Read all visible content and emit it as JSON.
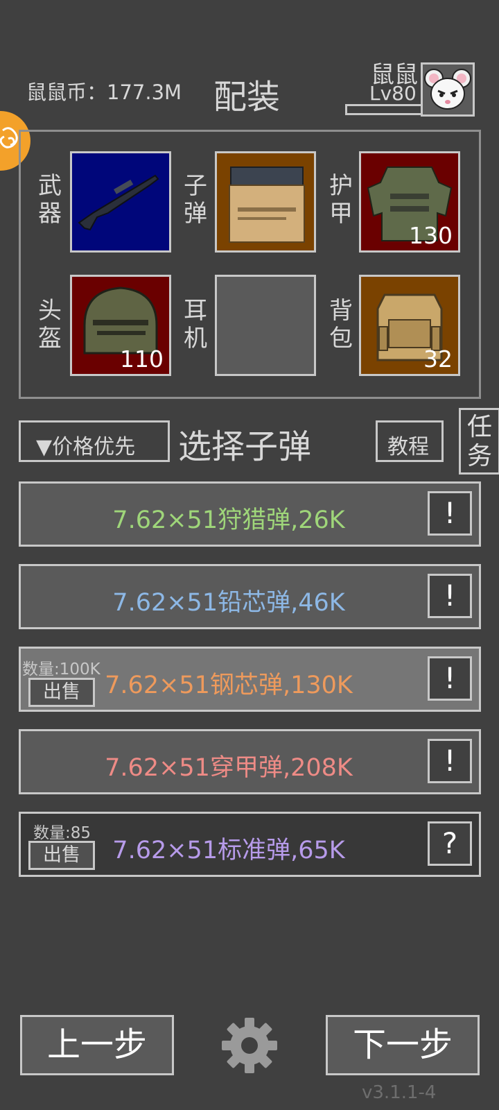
{
  "header": {
    "coins": "鼠鼠币：177.3M",
    "title": "配装",
    "user_name": "鼠鼠",
    "user_level": "Lv80",
    "level_progress": 0.0
  },
  "equipment": {
    "weapon_label": "武器",
    "ammo_label": "子弹",
    "armor_label": "护甲",
    "armor_count": "130",
    "helmet_label": "头盔",
    "helmet_count": "110",
    "headset_label": "耳机",
    "backpack_label": "背包",
    "backpack_count": "32"
  },
  "controls": {
    "sort_label": "▼价格优先",
    "section_title": "选择子弹",
    "tutorial_label": "教程",
    "task_label": "任务"
  },
  "ammo_list": [
    {
      "name": "7.62×51狩猎弹,26K",
      "color": "#9fd67a",
      "info": "!"
    },
    {
      "name": "7.62×51铅芯弹,46K",
      "color": "#8db8e6",
      "info": "!"
    },
    {
      "name": "7.62×51钢芯弹,130K",
      "color": "#ee9a5c",
      "info": "!",
      "quantity": "数量:100K",
      "sell": "出售"
    },
    {
      "name": "7.62×51穿甲弹,208K",
      "color": "#ee8b86",
      "info": "!"
    },
    {
      "name": "7.62×51标准弹,65K",
      "color": "#b79bea",
      "info": "?",
      "quantity": "数量:85",
      "sell": "出售"
    }
  ],
  "footer": {
    "prev_label": "上一步",
    "next_label": "下一步",
    "version": "v3.1.1-4"
  },
  "icons": {
    "weapon": "rifle-icon",
    "ammo": "ammo-box-icon",
    "armor": "body-armor-icon",
    "helmet": "helmet-icon",
    "backpack": "backpack-icon",
    "avatar": "mouse-avatar-icon",
    "settings": "gear-icon"
  }
}
